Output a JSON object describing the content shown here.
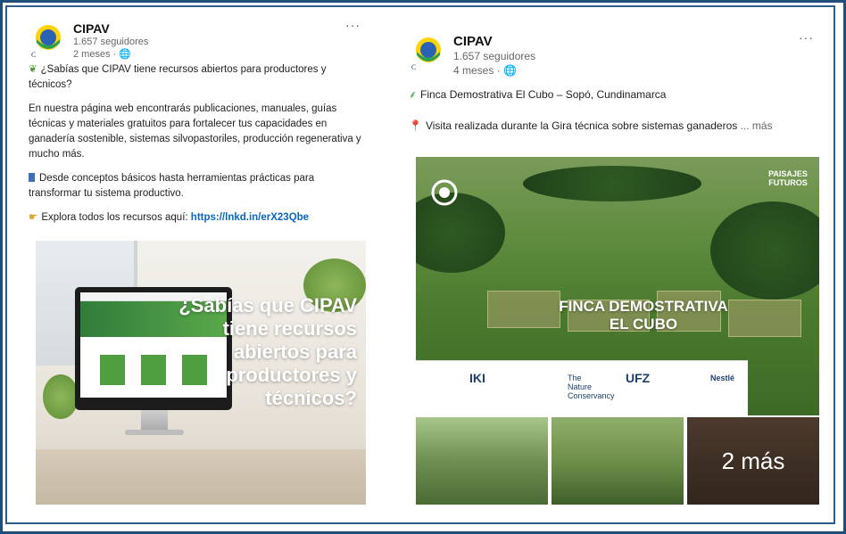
{
  "post_left": {
    "org": "CIPAV",
    "followers": "1.657 seguidores",
    "time": "2 meses · 🌐",
    "menu": "···",
    "p1": "¿Sabías que CIPAV tiene recursos abiertos para productores y técnicos?",
    "p2": "En nuestra página web encontrarás publicaciones, manuales, guías técnicas y materiales gratuitos para fortalecer tus capacidades en ganadería sostenible, sistemas silvopastoriles, producción regenerativa y mucho más.",
    "p3": "Desde conceptos básicos hasta herramientas prácticas para transformar tu sistema productivo.",
    "p4_prefix": "Explora todos los recursos aquí: ",
    "p4_link": "https://lnkd.in/erX23Qbe",
    "image_headline": "¿Sabías que CIPAV tiene recursos abiertos para productores y técnicos?"
  },
  "post_right": {
    "org": "CIPAV",
    "followers": "1.657 seguidores",
    "time": "4 meses · 🌐",
    "menu": "···",
    "line1": "Finca Demostrativa El Cubo – Sopó, Cundinamarca",
    "line2": "Visita realizada durante la Gira técnica sobre sistemas ganaderos",
    "more_link": " ... más",
    "image_title_1": "FINCA DEMOSTRATIVA",
    "image_title_2": "EL CUBO",
    "paisaje": "PAISAJES FUTUROS",
    "sponsors": [
      "IKI",
      "The Nature Conservancy",
      "UFZ",
      "Nestlé"
    ],
    "more_photos": "2 más"
  },
  "colors": {
    "frame": "#1f4e7a",
    "link": "#0a66c2"
  }
}
